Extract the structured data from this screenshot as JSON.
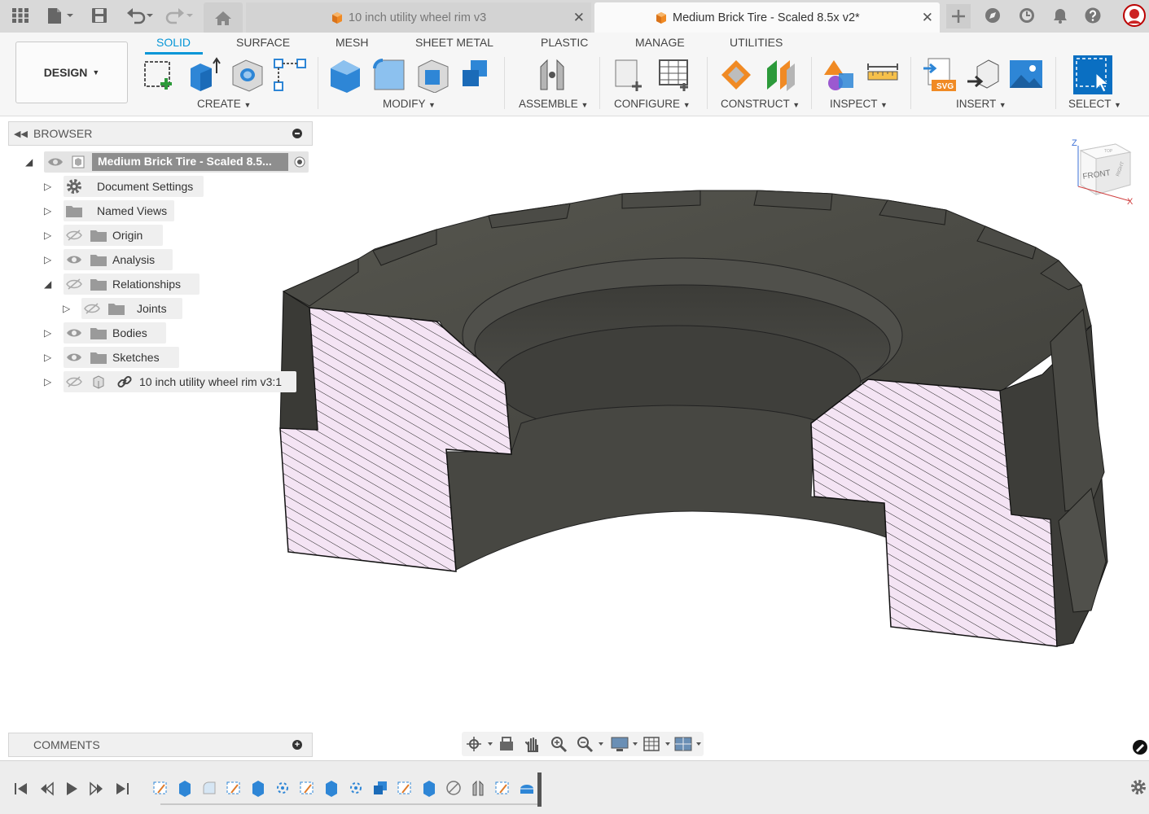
{
  "tabs": {
    "inactive_doc": "10 inch utility wheel rim v3",
    "active_doc": "Medium Brick Tire - Scaled 8.5x v2*",
    "close_glyph": "✕"
  },
  "workspace": {
    "label": "DESIGN"
  },
  "ribbon_tabs": [
    "SOLID",
    "SURFACE",
    "MESH",
    "SHEET METAL",
    "PLASTIC",
    "MANAGE",
    "UTILITIES"
  ],
  "ribbon_groups": {
    "create": "CREATE",
    "modify": "MODIFY",
    "assemble": "ASSEMBLE",
    "configure": "CONFIGURE",
    "construct": "CONSTRUCT",
    "inspect": "INSPECT",
    "insert": "INSERT",
    "select": "SELECT"
  },
  "browser": {
    "title": "BROWSER",
    "root": "Medium Brick Tire - Scaled 8.5...",
    "items": [
      "Document Settings",
      "Named Views",
      "Origin",
      "Analysis",
      "Relationships",
      "Joints",
      "Bodies",
      "Sketches",
      "10 inch utility wheel rim v3:1"
    ]
  },
  "comments": {
    "title": "COMMENTS"
  },
  "viewcube": {
    "face_front": "FRONT",
    "face_right": "RIGHT",
    "face_top": "TOP",
    "axis_z": "Z",
    "axis_x": "X"
  },
  "colors": {
    "accent": "#0696d7",
    "tire": "#4a4a46",
    "section_fill": "#f4e4f4",
    "select_button": "#0a6fc2",
    "orange_cube": "#f08a24"
  }
}
